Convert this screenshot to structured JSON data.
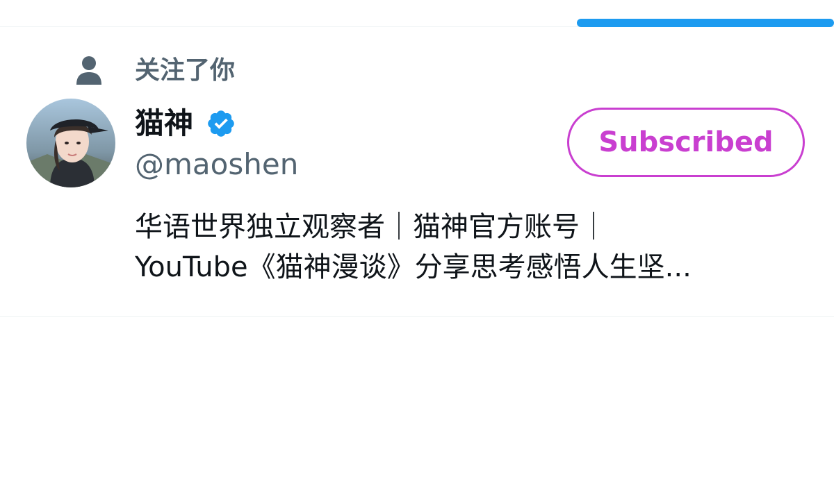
{
  "notification": {
    "text": "关注了你",
    "icon": "person-icon"
  },
  "user": {
    "display_name": "猫神",
    "handle": "@maoshen",
    "verified": true,
    "verified_icon": "verified-badge-icon",
    "avatar_alt": "avatar"
  },
  "actions": {
    "subscribe_label": "Subscribed"
  },
  "bio": {
    "line1": "华语世界独立观察者｜猫神官方账号｜",
    "line2": "YouTube《猫神漫谈》分享思考感悟人生坚..."
  },
  "colors": {
    "accent": "#1d9bf0",
    "subscribed": "#c93fd0",
    "secondary_text": "#536471",
    "primary_text": "#0f1419"
  }
}
